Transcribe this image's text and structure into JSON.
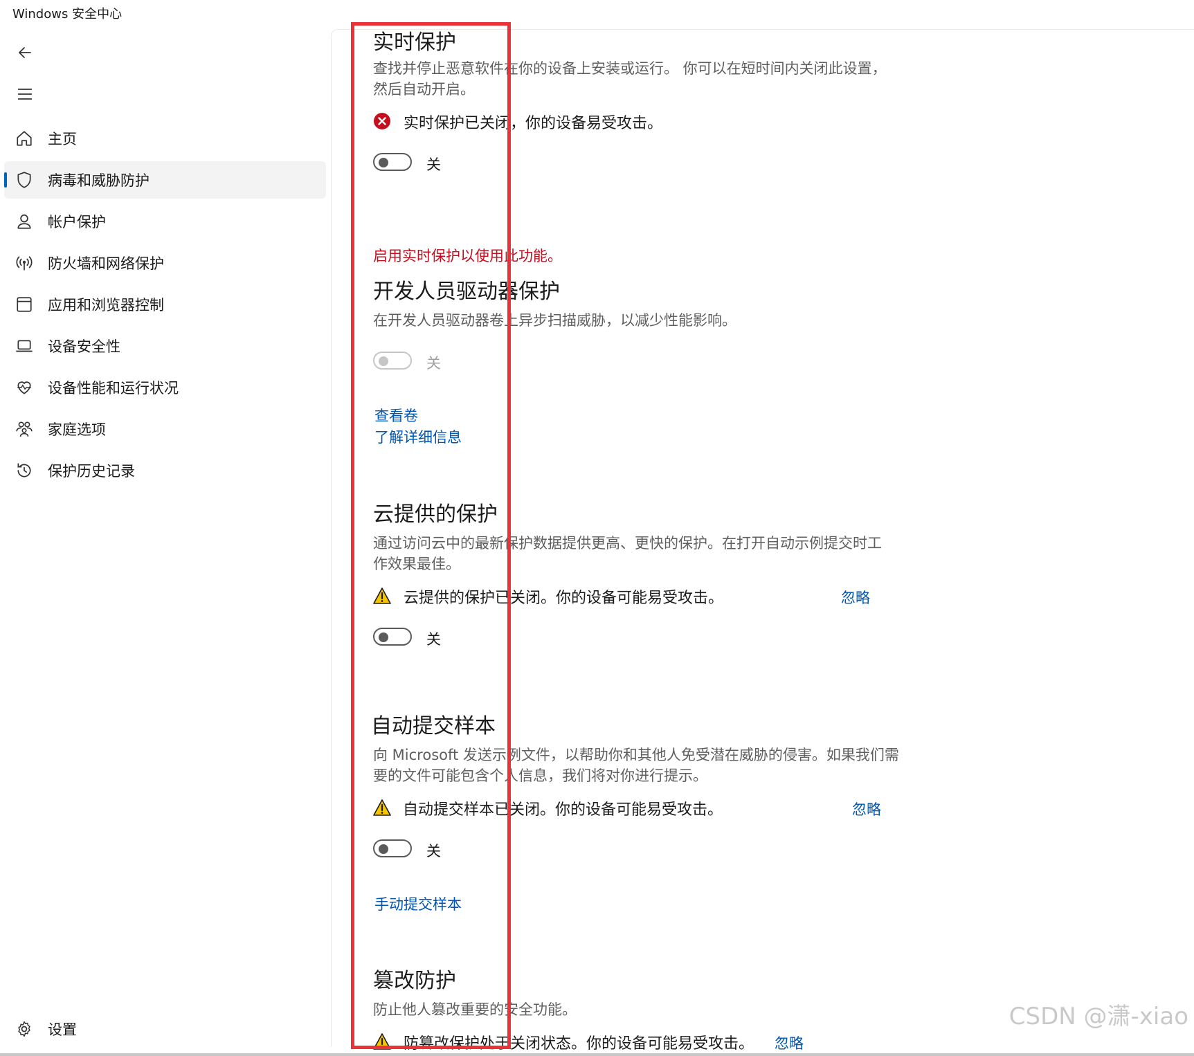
{
  "window": {
    "title": "Windows 安全中心"
  },
  "nav": {
    "items": [
      {
        "label": "主页",
        "icon": "home-icon"
      },
      {
        "label": "病毒和威胁防护",
        "icon": "shield-icon",
        "active": true
      },
      {
        "label": "帐户保护",
        "icon": "person-icon"
      },
      {
        "label": "防火墙和网络保护",
        "icon": "wifi-antenna-icon"
      },
      {
        "label": "应用和浏览器控制",
        "icon": "app-window-icon"
      },
      {
        "label": "设备安全性",
        "icon": "laptop-icon"
      },
      {
        "label": "设备性能和运行状况",
        "icon": "heart-pulse-icon"
      },
      {
        "label": "家庭选项",
        "icon": "family-icon"
      },
      {
        "label": "保护历史记录",
        "icon": "history-icon"
      }
    ],
    "settings_label": "设置"
  },
  "sections": {
    "realtime": {
      "title": "实时保护",
      "desc": "查找并停止恶意软件在你的设备上安装或运行。 你可以在短时间内关闭此设置，然后自动开启。",
      "status": "实时保护已关闭，你的设备易受攻击。",
      "toggle_label": "关"
    },
    "devdrive": {
      "note": "启用实时保护以使用此功能。",
      "title": "开发人员驱动器保护",
      "desc": "在开发人员驱动器卷上异步扫描威胁，以减少性能影响。",
      "toggle_label": "关",
      "link1": "查看卷",
      "link2": "了解详细信息"
    },
    "cloud": {
      "title": "云提供的保护",
      "desc": "通过访问云中的最新保护数据提供更高、更快的保护。在打开自动示例提交时工作效果最佳。",
      "status": "云提供的保护已关闭。你的设备可能易受攻击。",
      "dismiss": "忽略",
      "toggle_label": "关"
    },
    "autosubmit": {
      "title": "自动提交样本",
      "desc": "向 Microsoft 发送示例文件，以帮助你和其他人免受潜在威胁的侵害。如果我们需要的文件可能包含个人信息，我们将对你进行提示。",
      "status": "自动提交样本已关闭。你的设备可能易受攻击。",
      "dismiss": "忽略",
      "toggle_label": "关",
      "link": "手动提交样本"
    },
    "tamper": {
      "title": "篡改防护",
      "desc": "防止他人篡改重要的安全功能。",
      "status": "防篡改保护处于关闭状态。你的设备可能易受攻击。",
      "dismiss": "忽略"
    }
  },
  "watermark": "CSDN @潇-xiao",
  "colors": {
    "accent": "#0067c0",
    "error": "#c50f1f",
    "warning": "#f7c600",
    "highlight_box": "#e8333a"
  }
}
